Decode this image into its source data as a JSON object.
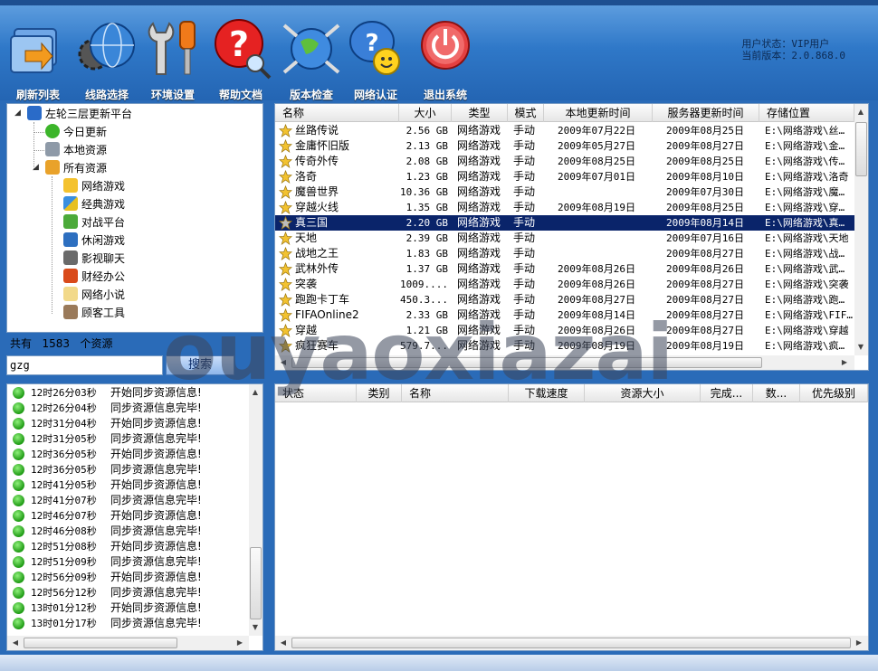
{
  "toolbar": {
    "buttons": [
      {
        "label": "刷新列表",
        "icon": "refresh-list-icon"
      },
      {
        "label": "线路选择",
        "icon": "globe-gear-icon"
      },
      {
        "label": "环境设置",
        "icon": "wrench-screwdriver-icon"
      },
      {
        "label": "帮助文档",
        "icon": "help-magnifier-icon"
      },
      {
        "label": "版本检查",
        "icon": "globe-satellite-icon"
      },
      {
        "label": "网络认证",
        "icon": "smiley-chat-icon"
      },
      {
        "label": "退出系统",
        "icon": "power-exit-icon"
      }
    ],
    "user_status": "用户状态：VIP用户",
    "version": "当前版本：2.0.868.0"
  },
  "tree": {
    "root": "左轮三层更新平台",
    "items": [
      {
        "label": "今日更新",
        "icon": "check-circle-icon"
      },
      {
        "label": "本地资源",
        "icon": "drive-icon"
      },
      {
        "label": "所有资源",
        "icon": "people-folder-icon"
      }
    ],
    "children": [
      {
        "label": "网络游戏",
        "icon": "star-icon"
      },
      {
        "label": "经典游戏",
        "icon": "puzzle-icon"
      },
      {
        "label": "对战平台",
        "icon": "players-icon"
      },
      {
        "label": "休闲游戏",
        "icon": "casual-game-icon"
      },
      {
        "label": "影视聊天",
        "icon": "video-chat-icon"
      },
      {
        "label": "财经办公",
        "icon": "finance-icon"
      },
      {
        "label": "网络小说",
        "icon": "novel-icon"
      },
      {
        "label": "顾客工具",
        "icon": "tools-icon"
      }
    ]
  },
  "count": {
    "prefix": "共有",
    "value": "1583",
    "suffix": "个资源"
  },
  "search": {
    "value": "gzg",
    "button": "搜索"
  },
  "resources": {
    "columns": [
      "名称",
      "大小",
      "类型",
      "模式",
      "本地更新时间",
      "服务器更新时间",
      "存储位置"
    ],
    "rows": [
      {
        "name": "丝路传说",
        "size": "2.56 GB",
        "type": "网络游戏",
        "mode": "手动",
        "local": "2009年07月22日",
        "server": "2009年08月25日",
        "path": "E:\\网络游戏\\丝…"
      },
      {
        "name": "金庸怀旧版",
        "size": "2.13 GB",
        "type": "网络游戏",
        "mode": "手动",
        "local": "2009年05月27日",
        "server": "2009年08月27日",
        "path": "E:\\网络游戏\\金…"
      },
      {
        "name": "传奇外传",
        "size": "2.08 GB",
        "type": "网络游戏",
        "mode": "手动",
        "local": "2009年08月25日",
        "server": "2009年08月25日",
        "path": "E:\\网络游戏\\传…"
      },
      {
        "name": "洛奇",
        "size": "1.23 GB",
        "type": "网络游戏",
        "mode": "手动",
        "local": "2009年07月01日",
        "server": "2009年08月10日",
        "path": "E:\\网络游戏\\洛奇"
      },
      {
        "name": "魔兽世界",
        "size": "10.36 GB",
        "type": "网络游戏",
        "mode": "手动",
        "local": "",
        "server": "2009年07月30日",
        "path": "E:\\网络游戏\\魔…"
      },
      {
        "name": "穿越火线",
        "size": "1.35 GB",
        "type": "网络游戏",
        "mode": "手动",
        "local": "2009年08月19日",
        "server": "2009年08月25日",
        "path": "E:\\网络游戏\\穿…"
      },
      {
        "name": "真三国",
        "size": "2.20 GB",
        "type": "网络游戏",
        "mode": "手动",
        "local": "",
        "server": "2009年08月14日",
        "path": "E:\\网络游戏\\真…",
        "selected": true
      },
      {
        "name": "天地",
        "size": "2.39 GB",
        "type": "网络游戏",
        "mode": "手动",
        "local": "",
        "server": "2009年07月16日",
        "path": "E:\\网络游戏\\天地"
      },
      {
        "name": "战地之王",
        "size": "1.83 GB",
        "type": "网络游戏",
        "mode": "手动",
        "local": "",
        "server": "2009年08月27日",
        "path": "E:\\网络游戏\\战…"
      },
      {
        "name": "武林外传",
        "size": "1.37 GB",
        "type": "网络游戏",
        "mode": "手动",
        "local": "2009年08月26日",
        "server": "2009年08月26日",
        "path": "E:\\网络游戏\\武…"
      },
      {
        "name": "突袭",
        "size": "1009....",
        "type": "网络游戏",
        "mode": "手动",
        "local": "2009年08月26日",
        "server": "2009年08月27日",
        "path": "E:\\网络游戏\\突袭"
      },
      {
        "name": "跑跑卡丁车",
        "size": "450.3...",
        "type": "网络游戏",
        "mode": "手动",
        "local": "2009年08月27日",
        "server": "2009年08月27日",
        "path": "E:\\网络游戏\\跑…"
      },
      {
        "name": "FIFAOnline2",
        "size": "2.33 GB",
        "type": "网络游戏",
        "mode": "手动",
        "local": "2009年08月14日",
        "server": "2009年08月27日",
        "path": "E:\\网络游戏\\FIF…"
      },
      {
        "name": "穿越",
        "size": "1.21 GB",
        "type": "网络游戏",
        "mode": "手动",
        "local": "2009年08月26日",
        "server": "2009年08月27日",
        "path": "E:\\网络游戏\\穿越"
      },
      {
        "name": "疯狂赛车",
        "size": "579.7...",
        "type": "网络游戏",
        "mode": "手动",
        "local": "2009年08月19日",
        "server": "2009年08月19日",
        "path": "E:\\网络游戏\\疯…"
      }
    ]
  },
  "log": [
    {
      "time": "12时26分03秒",
      "msg": "开始同步资源信息!"
    },
    {
      "time": "12时26分04秒",
      "msg": "同步资源信息完毕!"
    },
    {
      "time": "12时31分04秒",
      "msg": "开始同步资源信息!"
    },
    {
      "time": "12时31分05秒",
      "msg": "同步资源信息完毕!"
    },
    {
      "time": "12时36分05秒",
      "msg": "开始同步资源信息!"
    },
    {
      "time": "12时36分05秒",
      "msg": "同步资源信息完毕!"
    },
    {
      "time": "12时41分05秒",
      "msg": "开始同步资源信息!"
    },
    {
      "time": "12时41分07秒",
      "msg": "同步资源信息完毕!"
    },
    {
      "time": "12时46分07秒",
      "msg": "开始同步资源信息!"
    },
    {
      "time": "12时46分08秒",
      "msg": "同步资源信息完毕!"
    },
    {
      "time": "12时51分08秒",
      "msg": "开始同步资源信息!"
    },
    {
      "time": "12时51分09秒",
      "msg": "同步资源信息完毕!"
    },
    {
      "time": "12时56分09秒",
      "msg": "开始同步资源信息!"
    },
    {
      "time": "12时56分12秒",
      "msg": "同步资源信息完毕!"
    },
    {
      "time": "13时01分12秒",
      "msg": "开始同步资源信息!"
    },
    {
      "time": "13时01分17秒",
      "msg": "同步资源信息完毕!"
    }
  ],
  "downloads": {
    "columns": [
      "状态",
      "类别",
      "名称",
      "下载速度",
      "资源大小",
      "完成...",
      "数...",
      "优先级别"
    ]
  },
  "watermark": "ouyaoxiazai",
  "colors": {
    "toolbar": "#2f78c8",
    "selected_row": "#0a246a",
    "status_dot": "#1e9a14"
  }
}
